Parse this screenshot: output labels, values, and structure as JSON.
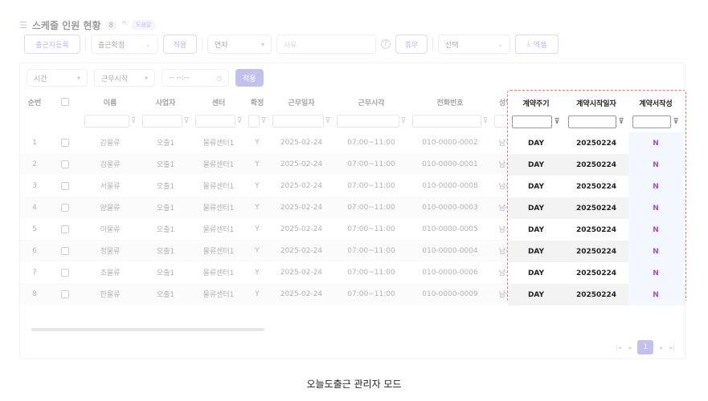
{
  "header": {
    "title": "스케줄 인원 현황",
    "count_badge": "8",
    "chevron": "^",
    "filter_badge": "도움말"
  },
  "toolbar": {
    "register_label": "출근자등록",
    "confirm_select": "출근확정",
    "apply_label": "적용",
    "type_select": "연차",
    "reason_placeholder": "사유",
    "help_glyph": "?",
    "leave_label": "휴무",
    "choice_select": "선택",
    "excel_label": "엑셀"
  },
  "subtoolbar": {
    "time_select": "시간",
    "work_start_select": "근무시작",
    "time_placeholder": "-- --:--",
    "apply_label": "적용"
  },
  "grid": {
    "columns": [
      "순번",
      "",
      "이름",
      "사업자",
      "센터",
      "확정",
      "근무일자",
      "근무시각",
      "전화번호",
      "성별"
    ],
    "rows": [
      [
        "1",
        "",
        "강물류",
        "오출1",
        "물류센터1",
        "Y",
        "2025-02-24",
        "07:00~11:00",
        "010-0000-0002",
        "남성"
      ],
      [
        "2",
        "",
        "김물류",
        "오출1",
        "물류센터1",
        "Y",
        "2025-02-24",
        "07:00~11:00",
        "010-0000-0001",
        "남성"
      ],
      [
        "3",
        "",
        "서물류",
        "오출1",
        "물류센터1",
        "Y",
        "2025-02-24",
        "07:00~11:00",
        "010-0000-0008",
        "남성"
      ],
      [
        "4",
        "",
        "양물류",
        "오출1",
        "물류센터1",
        "Y",
        "2025-02-24",
        "07:00~11:00",
        "010-0000-0003",
        "남성"
      ],
      [
        "5",
        "",
        "이물류",
        "오출1",
        "물류센터1",
        "Y",
        "2025-02-24",
        "07:00~11:00",
        "010-0000-0005",
        "남성"
      ],
      [
        "6",
        "",
        "정물류",
        "오출1",
        "물류센터1",
        "Y",
        "2025-02-24",
        "07:00~11:00",
        "010-0000-0004",
        "남성"
      ],
      [
        "7",
        "",
        "조물류",
        "오출1",
        "물류센터1",
        "Y",
        "2025-02-24",
        "07:00~11:00",
        "010-0000-0006",
        "남성"
      ],
      [
        "8",
        "",
        "한물류",
        "오출1",
        "물류센터1",
        "Y",
        "2025-02-24",
        "07:00~11:00",
        "010-0000-0009",
        "남성"
      ]
    ]
  },
  "highlight": {
    "columns": [
      "계약주기",
      "계약시작일자",
      "계약서작성"
    ],
    "rows": [
      [
        "DAY",
        "20250224",
        "N"
      ],
      [
        "DAY",
        "20250224",
        "N"
      ],
      [
        "DAY",
        "20250224",
        "N"
      ],
      [
        "DAY",
        "20250224",
        "N"
      ],
      [
        "DAY",
        "20250224",
        "N"
      ],
      [
        "DAY",
        "20250224",
        "N"
      ],
      [
        "DAY",
        "20250224",
        "N"
      ],
      [
        "DAY",
        "20250224",
        "N"
      ]
    ]
  },
  "pager": {
    "first": "|◂",
    "prev": "◂",
    "current": "1",
    "next": "▸",
    "last": "▸|"
  },
  "caption": "오늘도출근 관리자 모드",
  "colors": {
    "accent": "#7a74d8",
    "highlight_border": "#e07b6a",
    "n_flag": "#a44be0"
  }
}
